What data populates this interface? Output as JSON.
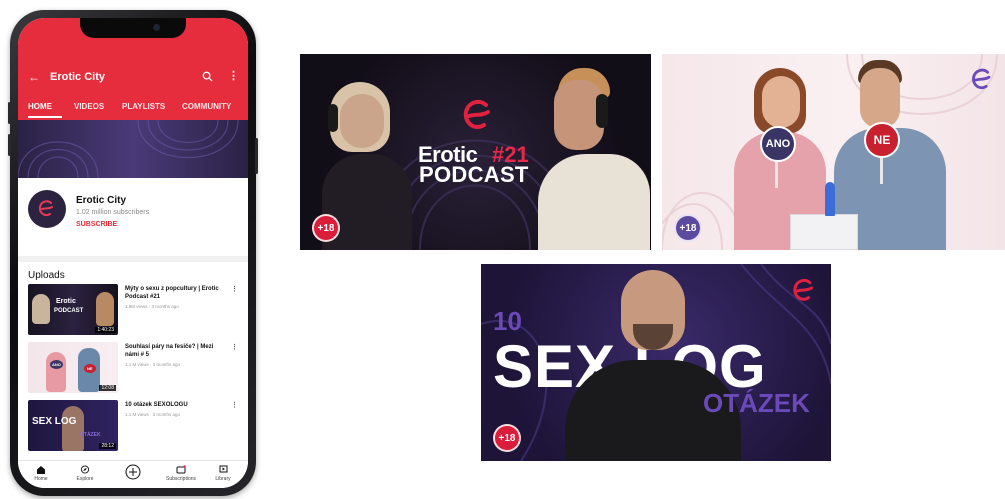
{
  "colors": {
    "youtube_red": "#e62d3d",
    "brand_purple": "#2b2340",
    "accent_red": "#d91d3a",
    "ano_bubble": "#3b3566",
    "ne_bubble": "#c8202e",
    "otazek_purple": "#6a4ab8"
  },
  "app": {
    "channel_title": "Erotic City",
    "tabs": [
      "HOME",
      "VIDEOS",
      "PLAYLISTS",
      "COMMUNITY"
    ],
    "channel": {
      "name": "Erotic City",
      "subscribers": "1.02 million subscribers",
      "subscribe_label": "SUBSCRIBE"
    },
    "uploads_title": "Uploads",
    "videos": [
      {
        "title": "Mýty o sexu z popcultury | Erotic Podcast #21",
        "meta": "1.9M views · 3 months ago",
        "duration": "1:40:23",
        "thumb_text_1": "Erotic",
        "thumb_text_2": "PODCAST"
      },
      {
        "title": "Souhlasí páry na fesiče? | Mezi námi # 5",
        "meta": "1.1 M views · 3 months ago",
        "duration": "12:08",
        "thumb_text_1": "ANO",
        "thumb_text_2": "NE"
      },
      {
        "title": "10 otázek SEXOLOGU",
        "meta": "1.1 M views · 3 months ago",
        "duration": "28:12",
        "thumb_text_1": "SEX LOG",
        "thumb_text_2": "OTÁZEK"
      }
    ],
    "nav": [
      {
        "label": "Home",
        "icon": "home-icon"
      },
      {
        "label": "Explore",
        "icon": "compass-icon"
      },
      {
        "label": "",
        "icon": "create-plus-icon"
      },
      {
        "label": "Subscriptions",
        "icon": "subscriptions-icon"
      },
      {
        "label": "Library",
        "icon": "library-icon"
      }
    ]
  },
  "thumbnails": {
    "podcast": {
      "brand": "Erotic",
      "episode": "#21",
      "subtitle": "PODCAST",
      "age": "+18"
    },
    "couple": {
      "yes": "ANO",
      "no": "NE",
      "age": "+18"
    },
    "sexolog": {
      "number": "10",
      "main": "SEX  LOG",
      "sub": "OTÁZEK",
      "age": "+18"
    }
  }
}
